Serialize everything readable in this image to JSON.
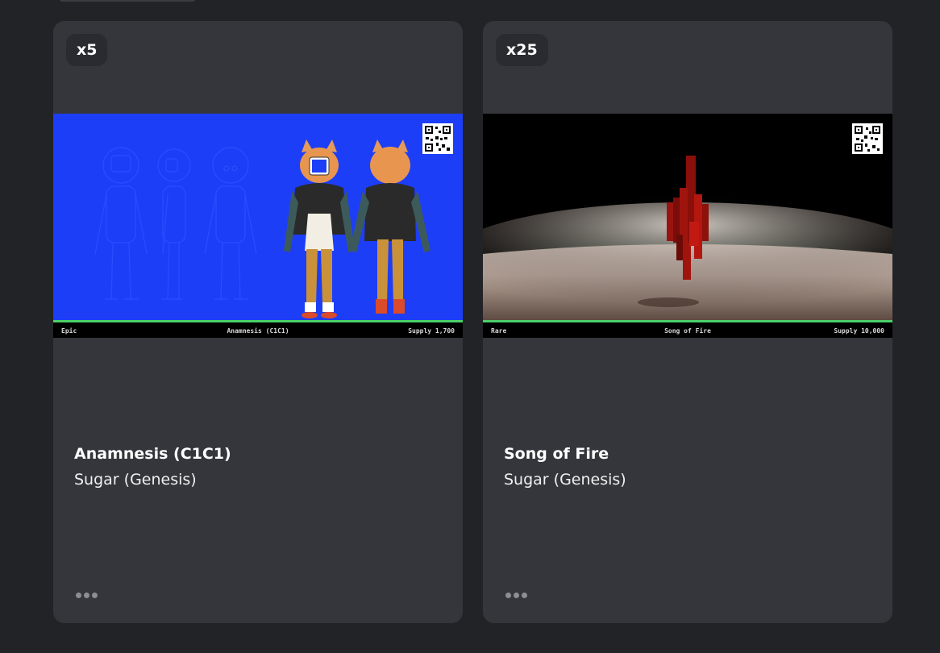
{
  "cards": [
    {
      "quantity": "x5",
      "title": "Anamnesis (C1C1)",
      "collection": "Sugar (Genesis)",
      "footer": {
        "rarity": "Epic",
        "name": "Anamnesis (C1C1)",
        "supply": "Supply 1,700"
      },
      "art_background": "#1d3ef7",
      "more_icon": "ellipsis-icon"
    },
    {
      "quantity": "x25",
      "title": "Song of Fire",
      "collection": "Sugar (Genesis)",
      "footer": {
        "rarity": "Rare",
        "name": "Song of Fire",
        "supply": "Supply 10,000"
      },
      "art_background": "#000000",
      "more_icon": "ellipsis-icon"
    }
  ],
  "colors": {
    "page_background": "#222327",
    "card_background": "#34363c",
    "footer_accent": "#4cd06a"
  }
}
